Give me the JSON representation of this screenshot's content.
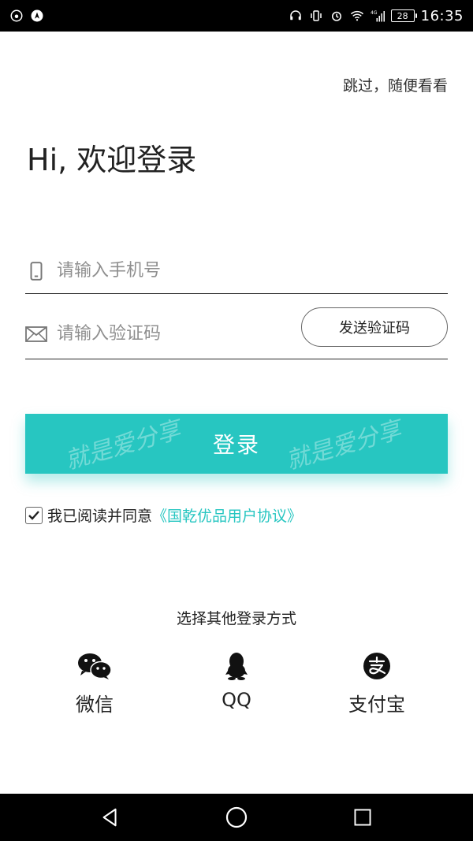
{
  "status_bar": {
    "time": "16:35",
    "battery": "28",
    "network": "4G",
    "icons_left": [
      "weibo-icon",
      "navigation-icon"
    ],
    "icons_right": [
      "headset-icon",
      "vibrate-icon",
      "alarm-icon",
      "wifi-icon",
      "signal-icon",
      "battery-icon"
    ]
  },
  "header": {
    "skip_label": "跳过，随便看看",
    "title": "Hi, 欢迎登录"
  },
  "form": {
    "phone_placeholder": "请输入手机号",
    "code_placeholder": "请输入验证码",
    "send_code_label": "发送验证码",
    "login_label": "登录",
    "watermark": "就是爱分享"
  },
  "agreement": {
    "checked": true,
    "text": "我已阅读并同意",
    "link": "《国乾优品用户协议》"
  },
  "other_login": {
    "title": "选择其他登录方式",
    "methods": [
      {
        "label": "微信",
        "icon": "wechat-icon"
      },
      {
        "label": "QQ",
        "icon": "qq-icon"
      },
      {
        "label": "支付宝",
        "icon": "alipay-icon"
      }
    ]
  },
  "colors": {
    "accent": "#27c6c1",
    "text": "#222222",
    "placeholder": "#8f8f8f"
  }
}
